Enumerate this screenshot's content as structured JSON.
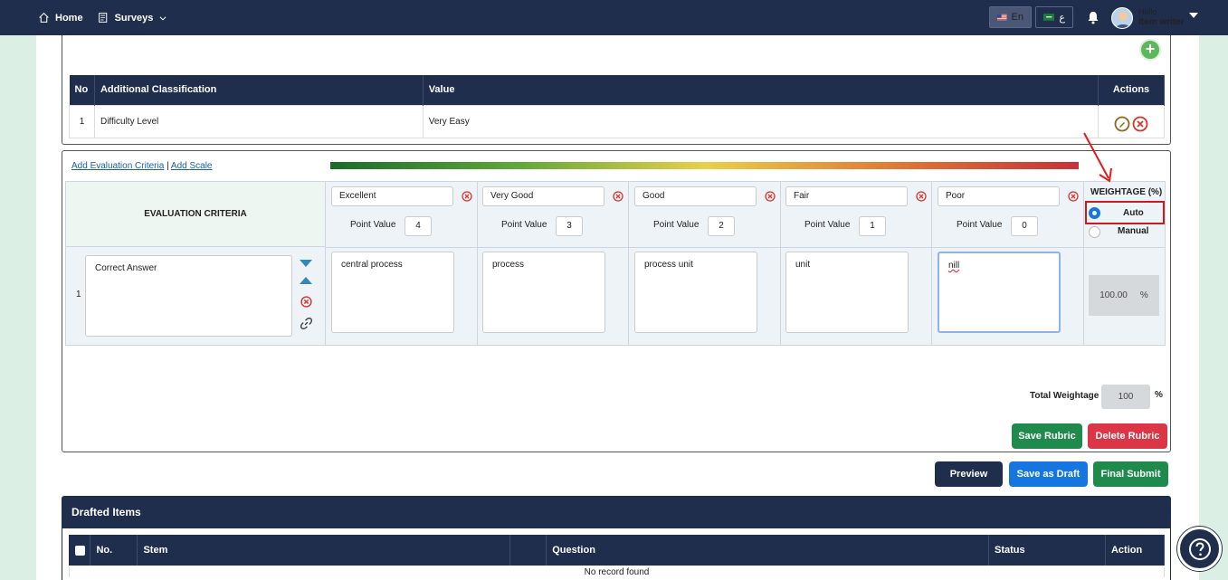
{
  "nav": {
    "home_label": "Home",
    "surveys_label": "Surveys",
    "lang_en_label": "En",
    "lang_ar_label": "ع",
    "user_greeting": "Hello",
    "user_name": "Item writer"
  },
  "classification": {
    "headers": [
      "No",
      "Additional Classification",
      "Value",
      "Actions"
    ],
    "rows": [
      {
        "no": "1",
        "classification": "Difficulty Level",
        "value": "Very Easy"
      }
    ]
  },
  "rubric": {
    "add_criteria_link": "Add Evaluation Criteria",
    "separator": "|",
    "add_scale_link": "Add Scale",
    "criteria_header": "EVALUATION CRITERIA",
    "point_value_label": "Point Value",
    "scales": [
      {
        "name": "Excellent",
        "points": "4"
      },
      {
        "name": "Very Good",
        "points": "3"
      },
      {
        "name": "Good",
        "points": "2"
      },
      {
        "name": "Fair",
        "points": "1"
      },
      {
        "name": "Poor",
        "points": "0"
      }
    ],
    "weightage_header": "WEIGHTAGE (%)",
    "auto_label": "Auto",
    "manual_label": "Manual",
    "weightage_mode": "Auto",
    "row": {
      "index": "1",
      "criterion": "Correct Answer",
      "descriptions": [
        "central process",
        "process",
        "process unit",
        "unit",
        "nill"
      ],
      "weight_value": "100.00",
      "weight_unit": "%"
    },
    "total_label": "Total Weightage",
    "total_value": "100",
    "total_unit": "%",
    "save_rubric_label": "Save Rubric",
    "delete_rubric_label": "Delete Rubric"
  },
  "actions": {
    "preview_label": "Preview",
    "save_draft_label": "Save as Draft",
    "final_submit_label": "Final Submit"
  },
  "drafted": {
    "title": "Drafted Items",
    "headers": [
      "No.",
      "Stem",
      "Question",
      "Status",
      "Action"
    ],
    "empty_message": "No record found"
  },
  "colors": {
    "navy": "#1f2e4d",
    "save_green": "#1e8a4c",
    "delete_red": "#dc3545",
    "draft_blue": "#1676e0",
    "submit_green": "#1e8a4c",
    "highlight_red": "#d01a1a"
  },
  "icons": [
    "home-icon",
    "survey-icon",
    "chevron-down-icon",
    "flag-us-icon",
    "flag-sa-icon",
    "bell-icon",
    "avatar",
    "plus-icon",
    "edit-icon",
    "delete-icon",
    "move-down-icon",
    "move-up-icon",
    "link-icon",
    "help-icon"
  ]
}
